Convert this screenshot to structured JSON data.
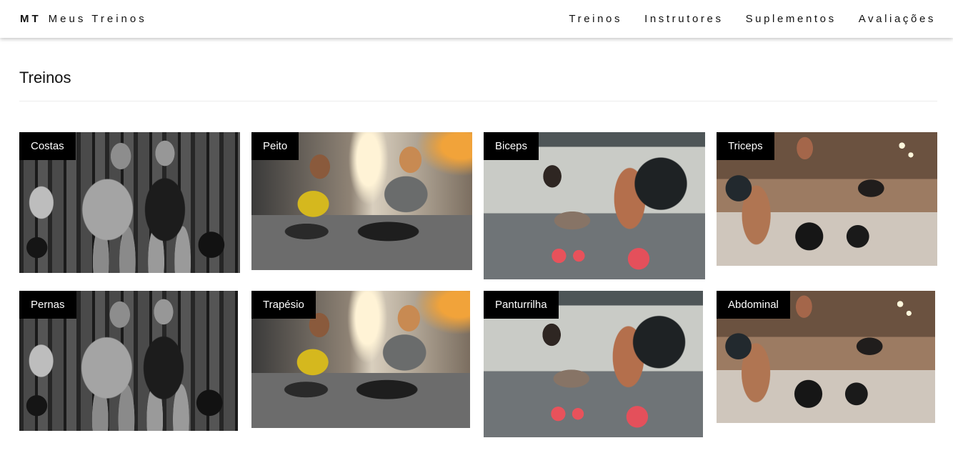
{
  "header": {
    "brand_abbr": "MT",
    "brand_name": "Meus Treinos",
    "nav": [
      "Treinos",
      "Instrutores",
      "Suplementos",
      "Avaliações"
    ]
  },
  "main": {
    "section_title": "Treinos",
    "cards": [
      {
        "label": "Costas",
        "image": "bodybuilders-gym-photo"
      },
      {
        "label": "Peito",
        "image": "couple-pushup-photo"
      },
      {
        "label": "Biceps",
        "image": "pushup-dumbbells-photo"
      },
      {
        "label": "Triceps",
        "image": "deadlift-gym-photo"
      },
      {
        "label": "Pernas",
        "image": "bodybuilders-gym-photo"
      },
      {
        "label": "Trapésio",
        "image": "couple-pushup-photo"
      },
      {
        "label": "Panturrilha",
        "image": "pushup-dumbbells-photo"
      },
      {
        "label": "Abdominal",
        "image": "deadlift-gym-photo"
      }
    ]
  },
  "colors": {
    "tag_background": "#000000",
    "tag_text": "#ffffff",
    "page_background": "#ffffff"
  }
}
